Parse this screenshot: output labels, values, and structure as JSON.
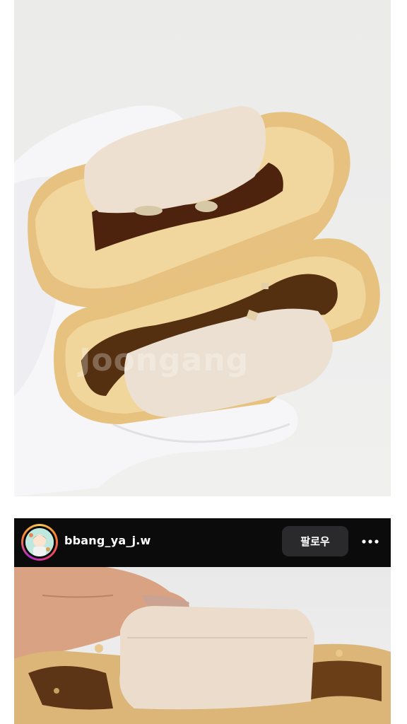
{
  "photo1": {
    "alt": "stacked pastry cut in half held in gloved hand",
    "watermark": "Joongang"
  },
  "post": {
    "username": "bbang_ya_j.w",
    "follow_label": "팔로우",
    "more_icon": "more-horizontal-icon"
  },
  "photo2": {
    "alt": "close-up of pastry cross-section held between fingers"
  },
  "colors": {
    "header_bg": "#0b0b0b",
    "follow_btn_bg": "#2a2a2c",
    "pastry_crust": "#e9c88a",
    "cream": "#efe2d3",
    "filling": "#5a2e12"
  }
}
